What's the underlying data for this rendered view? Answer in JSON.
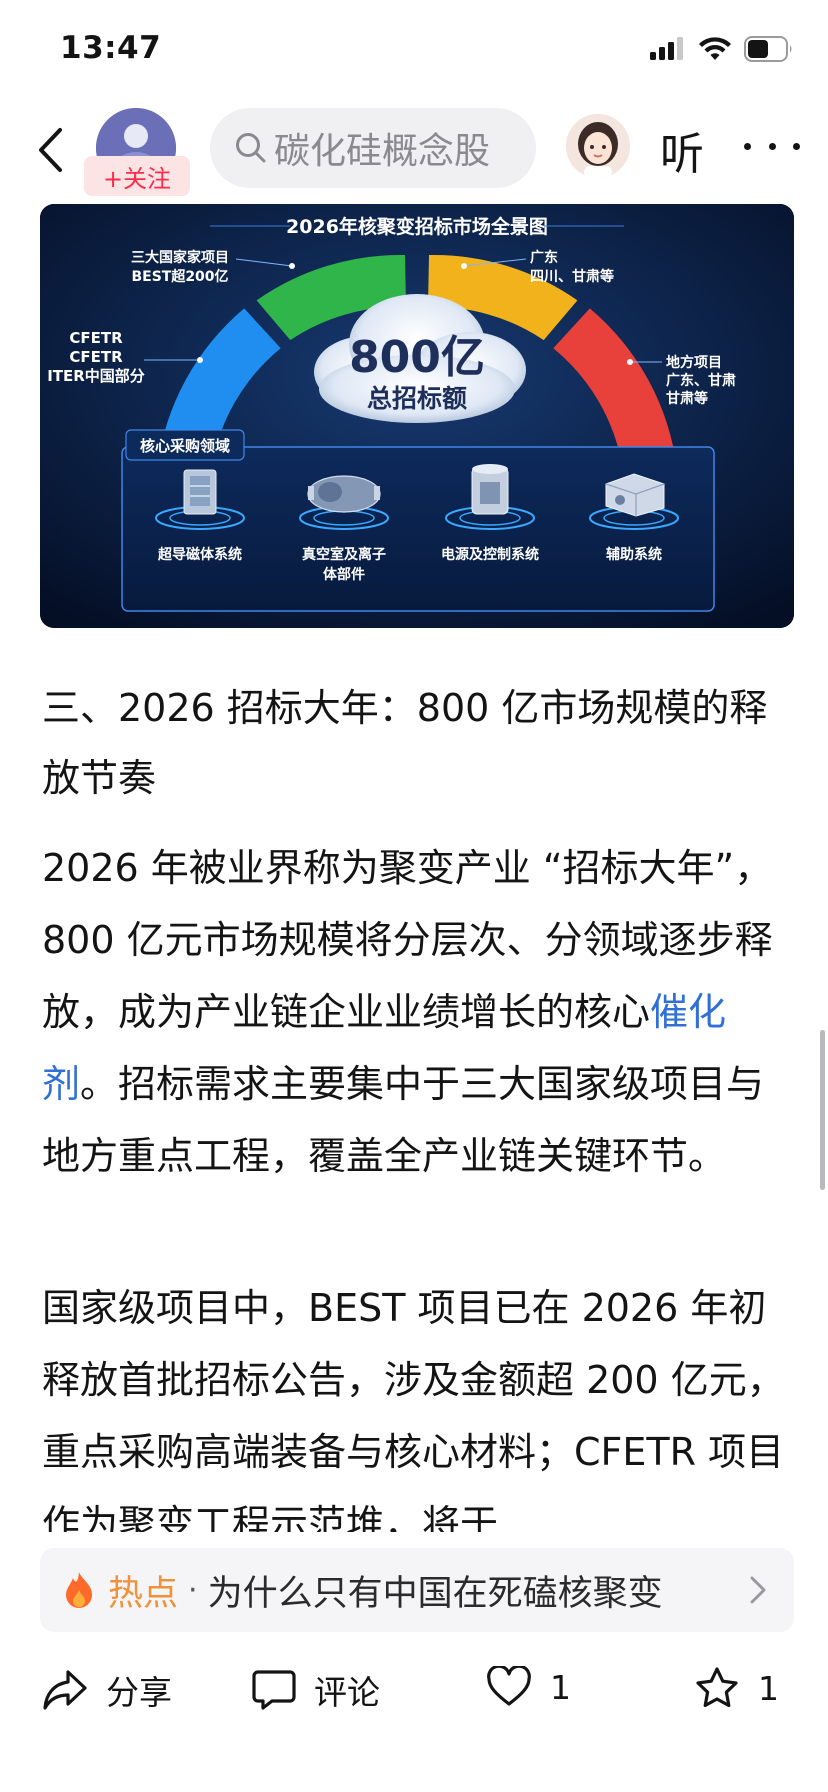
{
  "status_bar": {
    "time": "13:47"
  },
  "nav": {
    "follow_label": "+关注",
    "search_text": "碳化硅概念股",
    "listen_label": "听"
  },
  "infographic": {
    "title": "2026年核聚变招标市场全景图",
    "center_value": "800亿",
    "center_label": "总招标额",
    "left_label_1": "CFETR",
    "left_label_2": "CFETR",
    "left_label_3": "ITER中国部分",
    "top_left_label_1": "三大国家家项目",
    "top_left_label_2": "BEST超200亿",
    "top_right_label_1": "广东",
    "top_right_label_2": "四川、甘肃等",
    "right_label_1": "地方项目",
    "right_label_2": "广东、甘肃",
    "right_label_3": "甘肃等",
    "core_title": "核心采购领域",
    "items": [
      {
        "label_1": "超导磁体系统",
        "label_2": ""
      },
      {
        "label_1": "真空室及离子",
        "label_2": "体部件"
      },
      {
        "label_1": "电源及控制系统",
        "label_2": ""
      },
      {
        "label_1": "辅助系统",
        "label_2": ""
      }
    ],
    "colors": {
      "blue": "#1f8ef0",
      "green": "#2fb54a",
      "yellow": "#f2b21c",
      "red": "#e8403a"
    }
  },
  "article": {
    "heading": "三、2026 招标大年：800 亿市场规模的释放节奏",
    "p1_before": "2026 年被业界称为聚变产业 “招标大年”，800 亿元市场规模将分层次、分领域逐步释放，成为产业链企业业绩增长的核心",
    "p1_link": "催化剂",
    "p1_after": "。招标需求主要集中于三大国家级项目与地方重点工程，覆盖全产业链关键环节。",
    "p2": "国家级项目中，BEST 项目已在 2026 年初释放首批招标公告，涉及金额超 200 亿元，重点采购高端装备与核心材料；CFETR 项目作为聚变工程示范堆，将于"
  },
  "hot_bar": {
    "label": "热点",
    "separator": "·",
    "text": "为什么只有中国在死磕核聚变"
  },
  "actions": {
    "share_label": "分享",
    "comment_label": "评论",
    "like_count": "1",
    "fav_count": "1"
  }
}
